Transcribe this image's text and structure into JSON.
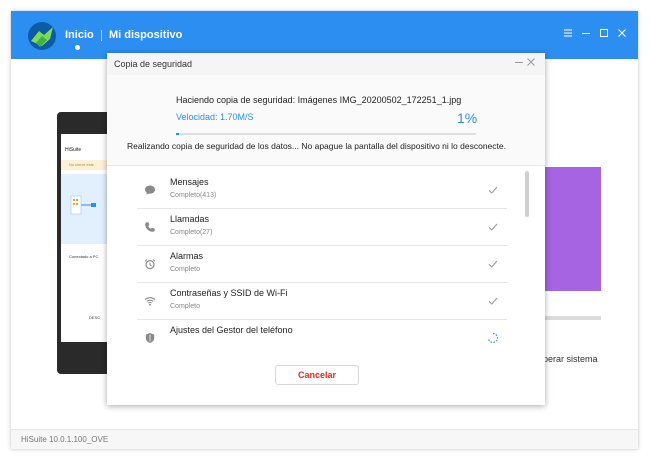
{
  "app": {
    "nav_home": "Inicio",
    "nav_device": "Mi dispositivo",
    "version": "HiSuite 10.0.1.100_OVE",
    "brand_color": "#2d8ef2",
    "window_controls": [
      "menu-icon",
      "minimize-icon",
      "maximize-icon",
      "close-icon"
    ]
  },
  "background": {
    "phone": {
      "title": "HiSuite",
      "notice": "No cierre este",
      "connected": "Conectado a PC",
      "button": "DESC"
    },
    "side_text": "perar sistema"
  },
  "dialog": {
    "title": "Copia de seguridad",
    "current_file": "Haciendo copia de seguridad: Imágenes  IMG_20200502_172251_1.jpg",
    "speed": "Velocidad: 1.70M/S",
    "percent": "1%",
    "progress": 0.01,
    "warning": "Realizando copia de seguridad de los datos... No apague la pantalla del dispositivo ni lo desconecte.",
    "cancel_label": "Cancelar",
    "items": [
      {
        "name": "Mensajes",
        "status": "Completo(413)",
        "icon": "message-icon",
        "state": "done"
      },
      {
        "name": "Llamadas",
        "status": "Completo(27)",
        "icon": "phone-icon",
        "state": "done"
      },
      {
        "name": "Alarmas",
        "status": "Completo",
        "icon": "alarm-icon",
        "state": "done"
      },
      {
        "name": "Contraseñas y SSID de Wi-Fi",
        "status": "Completo",
        "icon": "wifi-icon",
        "state": "done"
      },
      {
        "name": "Ajustes del Gestor del teléfono",
        "status": "",
        "icon": "shield-icon",
        "state": "in-progress"
      }
    ]
  }
}
